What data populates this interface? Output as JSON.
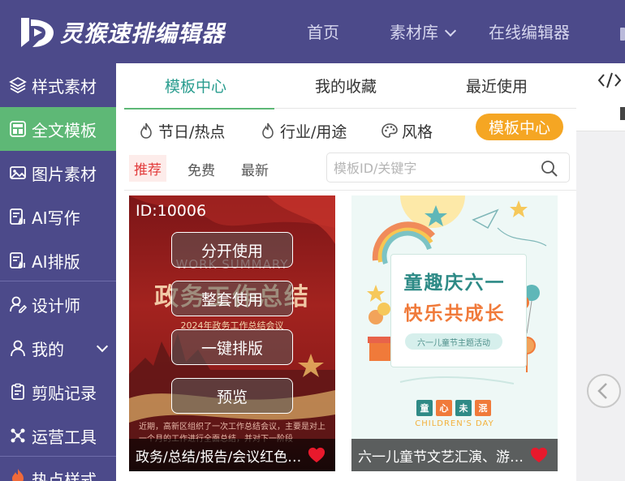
{
  "brand": {
    "name": "灵猴速排编辑器"
  },
  "nav": {
    "items": [
      "首页",
      "素材库",
      "在线编辑器"
    ]
  },
  "sidebar": {
    "items": [
      {
        "label": "样式素材",
        "icon": "layers-icon"
      },
      {
        "label": "全文模板",
        "icon": "template-icon",
        "active": true
      },
      {
        "label": "图片素材",
        "icon": "image-icon"
      },
      {
        "label": "AI写作",
        "icon": "ai-write-icon"
      },
      {
        "label": "AI排版",
        "icon": "ai-layout-icon"
      },
      {
        "label": "设计师",
        "icon": "designer-icon"
      },
      {
        "label": "我的",
        "icon": "user-icon"
      },
      {
        "label": "剪贴记录",
        "icon": "clipboard-icon"
      },
      {
        "label": "运营工具",
        "icon": "tools-icon"
      },
      {
        "label": "热点样式",
        "icon": "fire-icon"
      }
    ]
  },
  "tabs": [
    "模板中心",
    "我的收藏",
    "最近使用"
  ],
  "categories": [
    "节日/热点",
    "行业/用途",
    "风格"
  ],
  "category_pill": "模板中心",
  "filters": [
    "推荐",
    "免费",
    "最新"
  ],
  "search": {
    "placeholder": "模板ID/关键字"
  },
  "cards": [
    {
      "id_label": "ID:10006",
      "poster_sub": "WORK SUMMARY",
      "poster_title": "政务工作总结",
      "poster_year": "2024年政务工作总结会议",
      "poster_body": "近期，高新区组织了一次工作总结会议，主要是对上一个月的工作进行全面总结，并对下一阶段",
      "actions": [
        "分开使用",
        "整套使用",
        "一键排版",
        "预览"
      ],
      "caption": "政务/总结/报告/会议红色模板"
    },
    {
      "title1": "童趣庆六一",
      "title2": "快乐共成长",
      "tag": "六一儿童节主题活动",
      "chars": [
        "童",
        "心",
        "未",
        "泯"
      ],
      "en": "CHILDREN'S DAY",
      "caption": "六一儿童节文艺汇演、游园活动"
    }
  ],
  "colors": {
    "header_bg": "#4c4a8a",
    "sidebar_active": "#5eb876",
    "tab_active": "#2a9d8f",
    "pill": "#f5a623",
    "heart": "#e8192c"
  }
}
